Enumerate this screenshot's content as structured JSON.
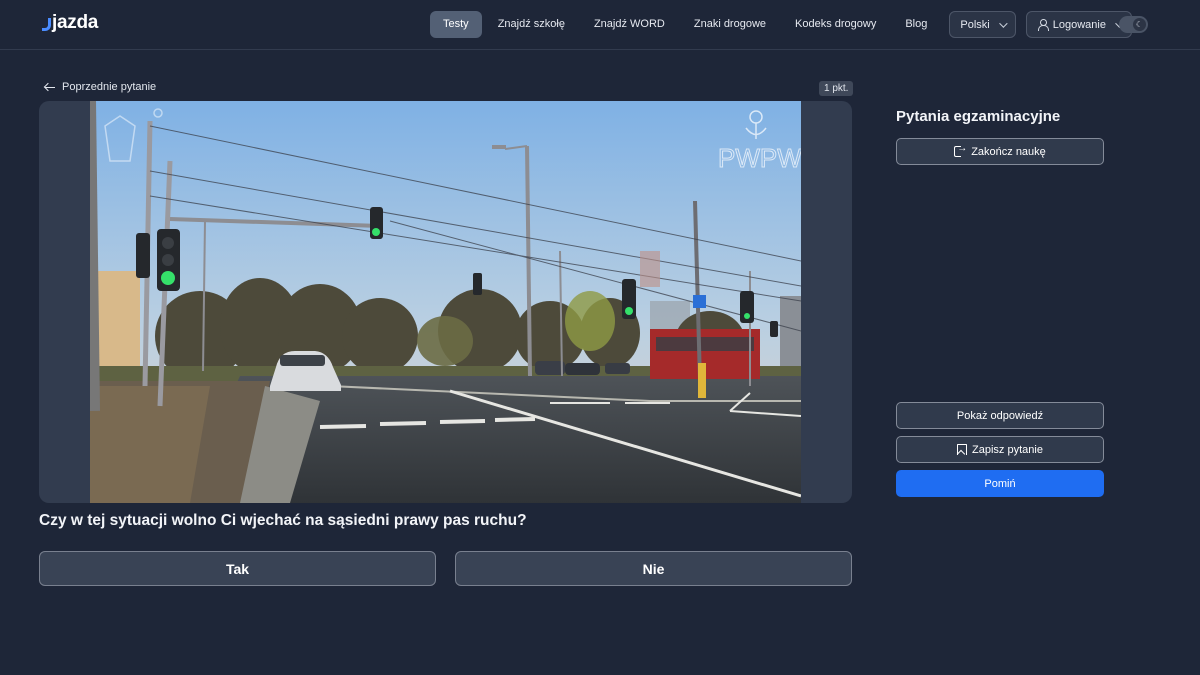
{
  "header": {
    "logo_text": "jazda",
    "nav": [
      {
        "label": "Testy",
        "active": true
      },
      {
        "label": "Znajdź szkołę"
      },
      {
        "label": "Znajdź WORD"
      },
      {
        "label": "Znaki drogowe"
      },
      {
        "label": "Kodeks drogowy"
      },
      {
        "label": "Blog"
      }
    ],
    "language_label": "Polski",
    "login_label": "Logowanie",
    "theme_toggle_icon": "moon-icon"
  },
  "main": {
    "prev_label": "Poprzednie pytanie",
    "points_label": "1 pkt.",
    "media": {
      "watermark_right": "PWPW"
    },
    "question": "Czy w tej sytuacji wolno Ci wjechać na sąsiedni prawy pas ruchu?",
    "answers": [
      {
        "label": "Tak"
      },
      {
        "label": "Nie"
      }
    ]
  },
  "sidebar": {
    "title": "Pytania egzaminacyjne",
    "finish_label": "Zakończ naukę",
    "show_answer_label": "Pokaż odpowiedź",
    "save_label": "Zapisz pytanie",
    "skip_label": "Pomiń"
  },
  "colors": {
    "background": "#1e2638",
    "primary": "#1f6df2",
    "traffic_light_green": "#35e06a"
  }
}
